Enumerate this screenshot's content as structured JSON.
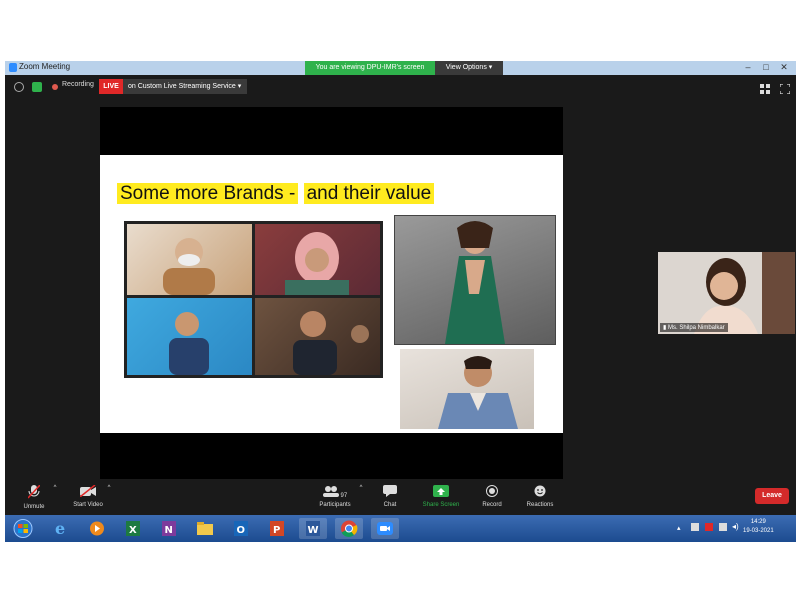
{
  "window": {
    "title": "Zoom Meeting",
    "viewing_banner": "You are viewing DPU-IMR's screen",
    "view_options": "View Options"
  },
  "status_bar": {
    "recording": "Recording",
    "live": "LIVE",
    "stream_service": "on Custom Live Streaming Service"
  },
  "slide": {
    "title_part1": "Some more Brands -",
    "title_part2": "and their value"
  },
  "participant": {
    "name": "Ms. Shilpa Nimbalkar"
  },
  "toolbar": {
    "unmute": "Unmute",
    "start_video": "Start Video",
    "participants_label": "Participants",
    "participants_count": "97",
    "chat": "Chat",
    "share_screen": "Share Screen",
    "record": "Record",
    "reactions": "Reactions",
    "leave": "Leave"
  },
  "taskbar": {
    "time": "14:29",
    "date": "19-03-2021",
    "apps": [
      "windows-start-icon",
      "internet-explorer-icon",
      "media-player-icon",
      "excel-icon",
      "onenote-icon",
      "file-explorer-icon",
      "outlook-icon",
      "powerpoint-icon",
      "word-icon",
      "chrome-icon",
      "zoom-icon"
    ]
  },
  "colors": {
    "zoom_blue": "#2d8cff",
    "banner_green": "#2fb24c",
    "live_red": "#e02828",
    "leave_red": "#d42a2a",
    "highlight_yellow": "#ffeb1f"
  }
}
